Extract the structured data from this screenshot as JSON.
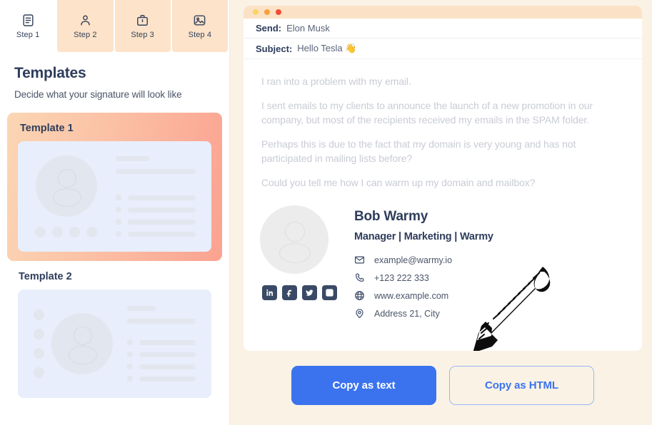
{
  "steps": [
    {
      "label": "Step 1",
      "icon": "document-icon",
      "active": true
    },
    {
      "label": "Step 2",
      "icon": "person-icon",
      "active": false
    },
    {
      "label": "Step 3",
      "icon": "briefcase-icon",
      "active": false
    },
    {
      "label": "Step 4",
      "icon": "image-icon",
      "active": false
    }
  ],
  "sidebar": {
    "title": "Templates",
    "subtitle": "Decide what your signature will look like",
    "templates": [
      {
        "name": "Template 1",
        "selected": true
      },
      {
        "name": "Template 2",
        "selected": false
      }
    ]
  },
  "mail": {
    "window_dots": [
      "#fcd462",
      "#f8a13c",
      "#f24b36"
    ],
    "send_label": "Send:",
    "send_value": "Elon Musk",
    "subject_label": "Subject:",
    "subject_value": "Hello Tesla 👋",
    "body": [
      "I ran into a problem with my email.",
      "I sent emails to my clients to announce the launch of a new promotion in our company, but most of the recipients received my emails in the SPAM folder.",
      "Perhaps this is due to the fact that my domain is very young and has not participated in mailing lists before?",
      "Could you tell me how I can warm up my domain and mailbox?"
    ]
  },
  "signature": {
    "name": "Bob Warmy",
    "role": "Manager | Marketing | Warmy",
    "contacts": [
      {
        "icon": "envelope-icon",
        "text": "example@warmy.io"
      },
      {
        "icon": "phone-icon",
        "text": "+123 222 333"
      },
      {
        "icon": "globe-icon",
        "text": "www.example.com"
      },
      {
        "icon": "location-pin-icon",
        "text": "Address 21, City"
      }
    ],
    "socials": [
      "linkedin-icon",
      "facebook-icon",
      "twitter-icon",
      "instagram-icon"
    ]
  },
  "footer": {
    "copy_text_label": "Copy as text",
    "copy_html_label": "Copy as HTML"
  },
  "colors": {
    "accent_blue": "#3b73ee",
    "panel_cream": "#faf2e5",
    "tab_peach": "#fce3c9",
    "navy": "#2e3d5c",
    "preview_blue": "#e8eefb"
  }
}
